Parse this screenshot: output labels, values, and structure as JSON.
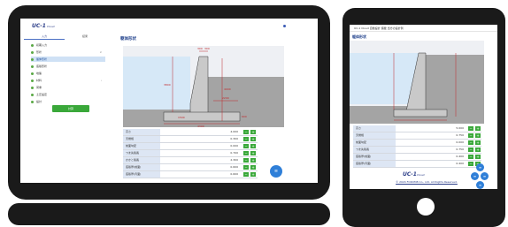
{
  "laptop": {
    "logo": "UC-1",
    "logo_suffix": "Cloud",
    "tabs": [
      "入力",
      "結果"
    ],
    "nav": [
      {
        "label": "初期入力",
        "selected": false,
        "chevron": ""
      },
      {
        "label": "形状",
        "selected": false,
        "chevron": "∨"
      },
      {
        "label": "躯体形状",
        "selected": true,
        "chevron": ""
      },
      {
        "label": "底版形状",
        "selected": false,
        "chevron": ""
      },
      {
        "label": "地盤",
        "selected": false,
        "chevron": ""
      },
      {
        "label": "材料",
        "selected": false,
        "chevron": "›"
      },
      {
        "label": "荷重",
        "selected": false,
        "chevron": ""
      },
      {
        "label": "土圧設定",
        "selected": false,
        "chevron": ""
      },
      {
        "label": "設計",
        "selected": false,
        "chevron": ""
      }
    ],
    "green_button": "計算",
    "page_title": "躯体形状",
    "drawing_labels": {
      "top_width": "300",
      "top_width2": "300",
      "wall_height": "3800",
      "right_height": "4000",
      "left_height": "1600",
      "base_a": "1500",
      "base_b": "2200",
      "footing": "600",
      "total": "4300"
    },
    "params": [
      {
        "label": "高さ",
        "value": "4.000"
      },
      {
        "label": "天端幅",
        "value": "0.300"
      },
      {
        "label": "前面勾配",
        "value": "0.000"
      },
      {
        "label": "つま先版長",
        "value": "0.700"
      },
      {
        "label": "かかと版長",
        "value": "2.300"
      },
      {
        "label": "底版厚(前面)",
        "value": "0.600"
      },
      {
        "label": "底版厚(背面)",
        "value": "0.600"
      }
    ],
    "unit": "m",
    "minus_glyph": "−",
    "plus_glyph": "+",
    "fab_glyph": "≡"
  },
  "tablet": {
    "topbar": "UC-1 Cloud 自動設計 擁壁 当方の設計例",
    "page_title": "躯体形状",
    "params": [
      {
        "label": "高さ",
        "value": "5.000"
      },
      {
        "label": "天端幅",
        "value": "0.750"
      },
      {
        "label": "前面勾配",
        "value": "0.000"
      },
      {
        "label": "つま先版長",
        "value": "0.750"
      },
      {
        "label": "底版厚(前面)",
        "value": "0.400"
      },
      {
        "label": "底版厚(背面)",
        "value": "0.400"
      }
    ],
    "footer_logo": "UC-1",
    "footer_logo_suffix": "Cloud",
    "copyright": "© 2024 FORUM8 Co., Ltd. All Rights Reserved.",
    "minus_glyph": "−",
    "plus_glyph": "+",
    "fab_glyph": "≡"
  },
  "colors": {
    "accent": "#2b3d88",
    "green": "#3aa83a",
    "fab": "#2f7fd8",
    "ground": "#a4a4a4",
    "concrete": "#c9c9c9",
    "dim": "#c0282b",
    "sky": "#d6e8f7"
  }
}
